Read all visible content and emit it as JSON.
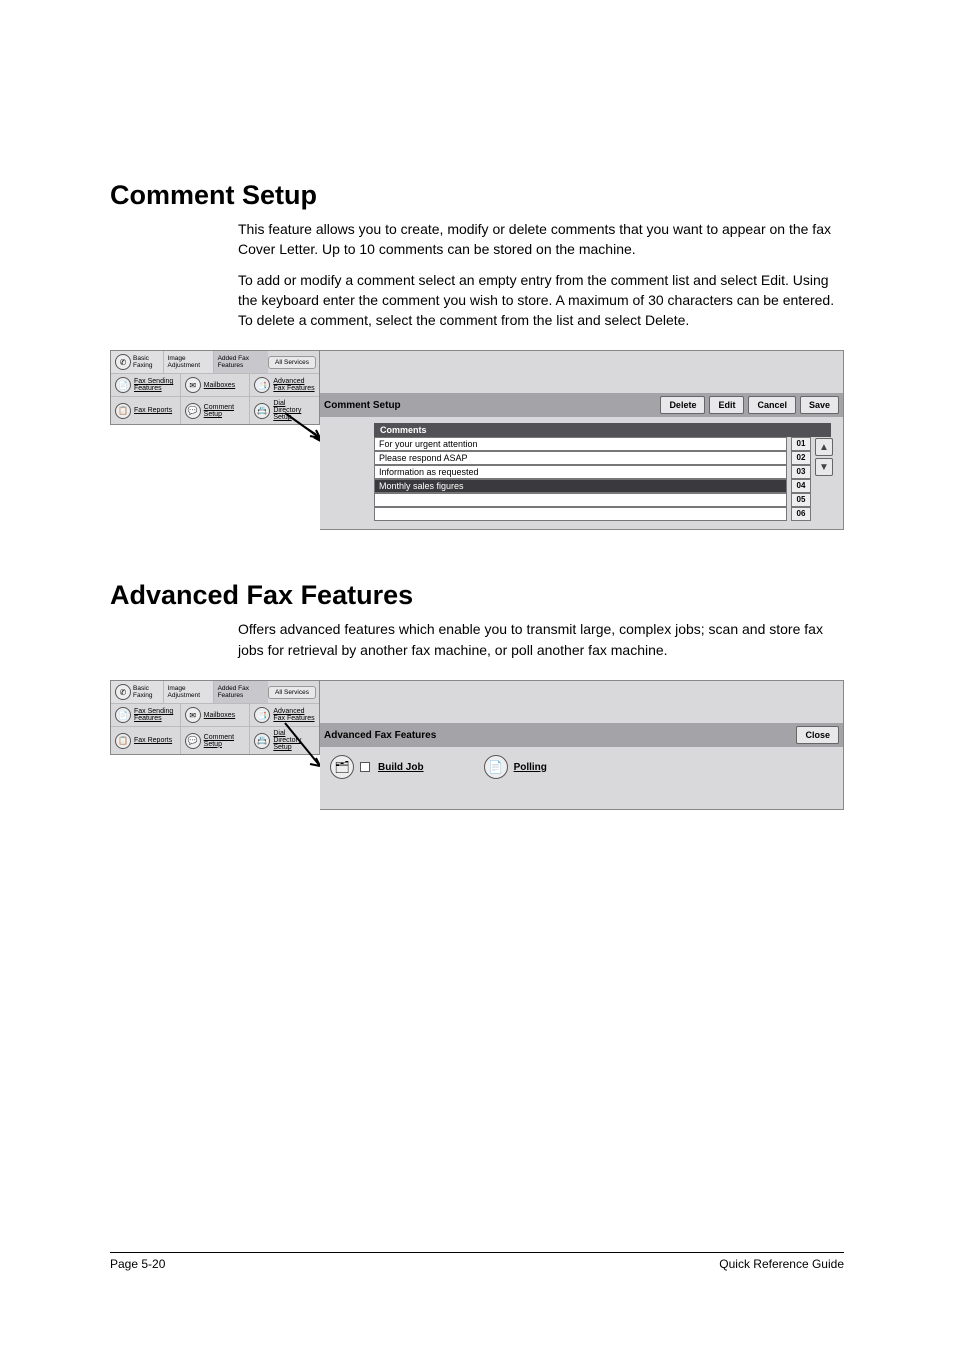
{
  "section1": {
    "title": "Comment Setup",
    "para1": "This feature allows you to create, modify or delete comments that you want to appear on the fax Cover Letter. Up to 10 comments can be stored on the machine.",
    "para2": "To add or modify a comment select an empty entry from the comment list and select Edit. Using the keyboard enter the comment you wish to store. A maximum of 30 characters can be entered. To delete a comment, select the comment from the list and select Delete."
  },
  "nav": {
    "tabs": {
      "basic": "Basic Faxing",
      "image": "Image Adjustment",
      "added": "Added Fax Features"
    },
    "all_services": "All Services",
    "fax_sending": "Fax Sending Features",
    "mailboxes": "Mailboxes",
    "advanced_fax": "Advanced Fax Features",
    "fax_reports": "Fax Reports",
    "comment_setup": "Comment Setup",
    "dial_directory": "Dial Directory Setup"
  },
  "comment_panel": {
    "title": "Comment Setup",
    "buttons": {
      "delete": "Delete",
      "edit": "Edit",
      "cancel": "Cancel",
      "save": "Save"
    },
    "header": "Comments",
    "rows": [
      {
        "text": "For your urgent attention",
        "idx": "01"
      },
      {
        "text": "Please respond ASAP",
        "idx": "02"
      },
      {
        "text": "Information as requested",
        "idx": "03"
      },
      {
        "text": "Monthly sales figures",
        "idx": "04"
      },
      {
        "text": "",
        "idx": "05"
      },
      {
        "text": "",
        "idx": "06"
      }
    ]
  },
  "section2": {
    "title": "Advanced Fax Features",
    "para1": "Offers advanced features which enable you to transmit large, complex jobs; scan and store fax jobs for retrieval by another fax machine, or poll another fax machine."
  },
  "adv_panel": {
    "title": "Advanced Fax Features",
    "close": "Close",
    "build_job": "Build Job",
    "polling": "Polling"
  },
  "footer": {
    "left": "Page 5-20",
    "right": "Quick Reference Guide"
  }
}
